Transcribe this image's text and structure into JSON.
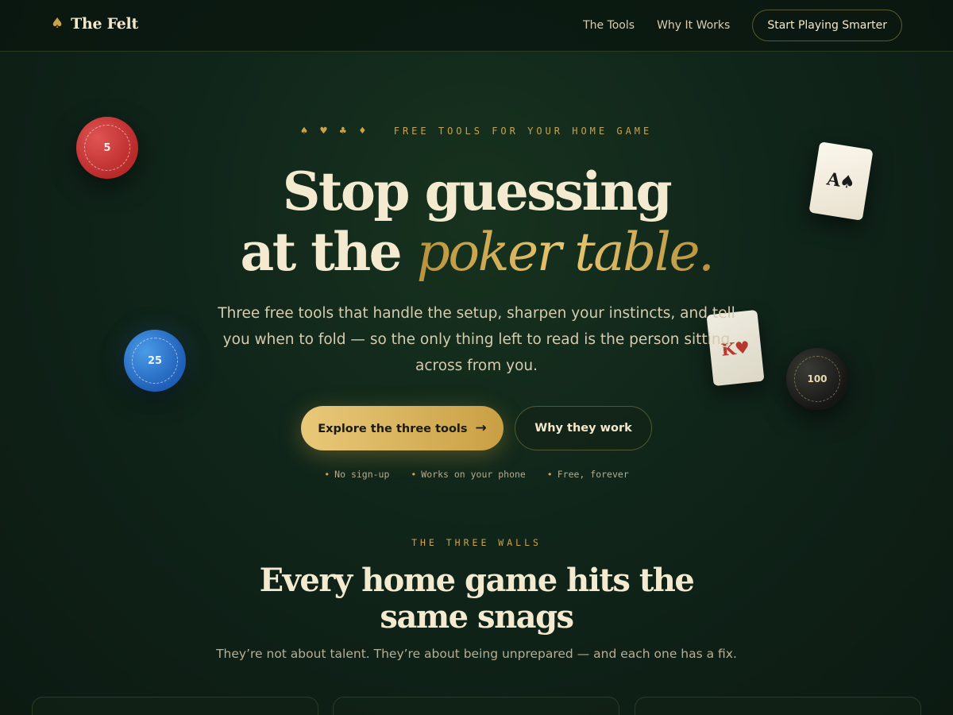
{
  "nav": {
    "brand_icon": "♠",
    "brand_name": "The Felt",
    "links": [
      {
        "label": "The Tools"
      },
      {
        "label": "Why It Works"
      }
    ],
    "cta_label": "Start Playing Smarter"
  },
  "hero": {
    "suits": [
      "♠",
      "♥",
      "♣",
      "♦"
    ],
    "eyebrow": "FREE TOOLS FOR YOUR HOME GAME",
    "title_line1": "Stop guessing",
    "title_line2_plain": "at the ",
    "title_line2_accent": "poker table.",
    "subtitle": "Three free tools that handle the setup, sharpen your instincts, and tell you when to fold — so the only thing left to read is the person sitting across from you.",
    "primary_cta": "Explore the three tools",
    "primary_cta_arrow": "→",
    "secondary_cta": "Why they work",
    "perks": [
      "No sign-up",
      "Works on your phone",
      "Free, forever"
    ],
    "perk_bullet": "•"
  },
  "decor": {
    "chips": [
      {
        "value": "5",
        "color": "#c93434"
      },
      {
        "value": "25",
        "color": "#2a6fc4"
      },
      {
        "value": "100",
        "color": "#1e1e1c"
      }
    ],
    "cards": [
      {
        "rank": "A",
        "suit": "♠"
      },
      {
        "rank": "K",
        "suit": "♥"
      }
    ]
  },
  "section": {
    "eyebrow": "THE THREE WALLS",
    "title": "Every home game hits the same snags",
    "subtitle": "They’re not about talent. They’re about being unprepared — and each one has a fix."
  },
  "colors": {
    "accent_gold": "#c9a24c",
    "background": "#10251a",
    "text_cream": "#f4ead0"
  }
}
